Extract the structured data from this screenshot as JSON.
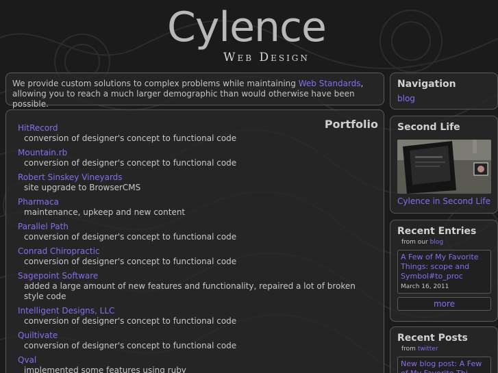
{
  "header": {
    "title": "Cylence",
    "subtitle": "Web Design"
  },
  "intro": {
    "text_before": "We provide custom solutions to complex problems while maintaining ",
    "link": "Web Standards",
    "text_after": ", allowing you to reach a much larger demographic than would otherwise have been possible."
  },
  "portfolio": {
    "heading": "Portfolio",
    "items": [
      {
        "name": "HitRecord",
        "desc": "conversion of designer's concept to functional code"
      },
      {
        "name": "Mountain.rb",
        "desc": "conversion of designer's concept to functional code"
      },
      {
        "name": "Robert Sinskey Vineyards",
        "desc": "site upgrade to BrowserCMS"
      },
      {
        "name": "Pharmaca",
        "desc": "maintenance, upkeep and new content"
      },
      {
        "name": "Parallel Path",
        "desc": "conversion of designer's concept to functional code"
      },
      {
        "name": "Conrad Chiropractic",
        "desc": "conversion of designer's concept to functional code"
      },
      {
        "name": "Sagepoint Software",
        "desc": "added a large amount of new features and functionality, repaired a lot of broken style code"
      },
      {
        "name": "Intelligent Designs, LLC",
        "desc": "conversion of designer's concept to functional code"
      },
      {
        "name": "Quiltivate",
        "desc": "conversion of designer's concept to functional code"
      },
      {
        "name": "Qval",
        "desc": "implemented some features using ruby"
      }
    ]
  },
  "sidebar": {
    "navigation": {
      "heading": "Navigation",
      "links": [
        "blog"
      ]
    },
    "second_life": {
      "heading": "Second Life",
      "link": "Cylence in Second Life"
    },
    "recent_entries": {
      "heading": "Recent Entries",
      "from_label": "from our",
      "from_link": "blog",
      "entry_title": "A Few of My Favorite Things: scope and Symbol#to_proc",
      "entry_date": "March 16, 2011",
      "more_label": "more"
    },
    "recent_posts": {
      "heading": "Recent Posts",
      "from_label": "from",
      "from_link": "twitter",
      "post_title": "New blog post: A Few of My Favorite Thi..."
    }
  },
  "colors": {
    "link": "#8a6cf0",
    "background": "#1b1b1b",
    "panel_border": "#5a5a5a"
  }
}
